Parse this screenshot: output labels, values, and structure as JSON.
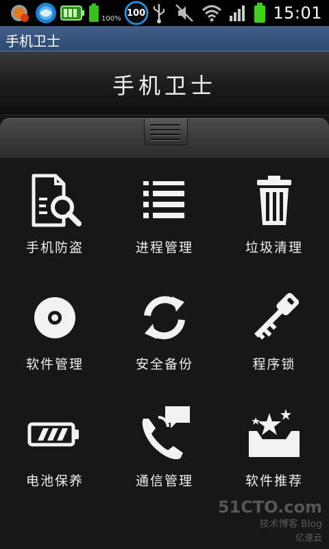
{
  "status_bar": {
    "battery_percent_label": "100%",
    "notification_count": "100",
    "time": "15:01"
  },
  "app_title": "手机卫士",
  "header_title": "手机卫士",
  "grid": [
    {
      "label": "手机防盗",
      "icon": "document-search-icon"
    },
    {
      "label": "进程管理",
      "icon": "list-icon"
    },
    {
      "label": "垃圾清理",
      "icon": "trash-icon"
    },
    {
      "label": "软件管理",
      "icon": "disc-icon"
    },
    {
      "label": "安全备份",
      "icon": "sync-icon"
    },
    {
      "label": "程序锁",
      "icon": "key-icon"
    },
    {
      "label": "电池保养",
      "icon": "battery-icon"
    },
    {
      "label": "通信管理",
      "icon": "phone-chat-icon"
    },
    {
      "label": "软件推荐",
      "icon": "star-box-icon"
    }
  ],
  "watermark": {
    "site": "51CTO.com",
    "subtitle": "技术博客  Blog",
    "brand": "亿速云"
  },
  "colors": {
    "title_bar": "#3f5f8a",
    "background": "#171717",
    "icon": "#f2f2f2"
  }
}
